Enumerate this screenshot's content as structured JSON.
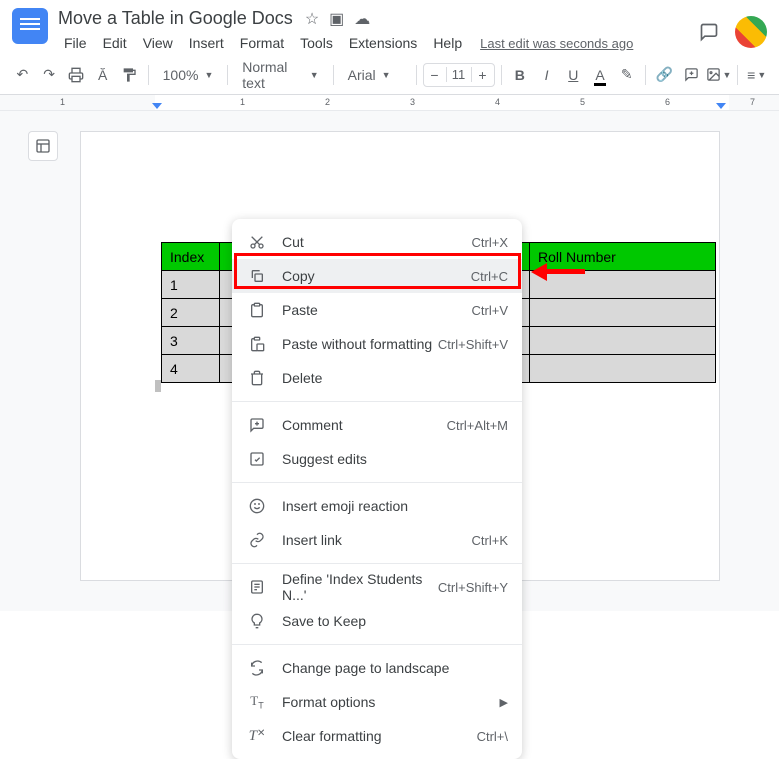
{
  "doc": {
    "title": "Move a Table in Google Docs"
  },
  "menus": [
    "File",
    "Edit",
    "View",
    "Insert",
    "Format",
    "Tools",
    "Extensions",
    "Help"
  ],
  "last_edit": "Last edit was seconds ago",
  "toolbar": {
    "zoom": "100%",
    "style": "Normal text",
    "font": "Arial",
    "font_size": "11"
  },
  "ruler": [
    "1",
    "1",
    "2",
    "3",
    "4",
    "5",
    "6",
    "7"
  ],
  "table": {
    "headers": [
      "Index",
      "",
      "Roll Number"
    ],
    "rows": [
      [
        "1"
      ],
      [
        "2"
      ],
      [
        "3"
      ],
      [
        "4"
      ]
    ]
  },
  "context_menu": [
    {
      "icon": "cut",
      "label": "Cut",
      "shortcut": "Ctrl+X"
    },
    {
      "icon": "copy",
      "label": "Copy",
      "shortcut": "Ctrl+C",
      "highlighted": true
    },
    {
      "icon": "paste",
      "label": "Paste",
      "shortcut": "Ctrl+V"
    },
    {
      "icon": "paste-plain",
      "label": "Paste without formatting",
      "shortcut": "Ctrl+Shift+V"
    },
    {
      "icon": "delete",
      "label": "Delete",
      "shortcut": ""
    },
    {
      "sep": true
    },
    {
      "icon": "comment",
      "label": "Comment",
      "shortcut": "Ctrl+Alt+M"
    },
    {
      "icon": "suggest",
      "label": "Suggest edits",
      "shortcut": ""
    },
    {
      "sep": true
    },
    {
      "icon": "emoji",
      "label": "Insert emoji reaction",
      "shortcut": ""
    },
    {
      "icon": "link",
      "label": "Insert link",
      "shortcut": "Ctrl+K"
    },
    {
      "sep": true
    },
    {
      "icon": "define",
      "label": "Define 'Index Students N...'",
      "shortcut": "Ctrl+Shift+Y"
    },
    {
      "icon": "keep",
      "label": "Save to Keep",
      "shortcut": ""
    },
    {
      "sep": true
    },
    {
      "icon": "landscape",
      "label": "Change page to landscape",
      "shortcut": ""
    },
    {
      "icon": "format-opts",
      "label": "Format options",
      "arrow": true
    },
    {
      "icon": "clear-fmt",
      "label": "Clear formatting",
      "shortcut": "Ctrl+\\"
    }
  ]
}
